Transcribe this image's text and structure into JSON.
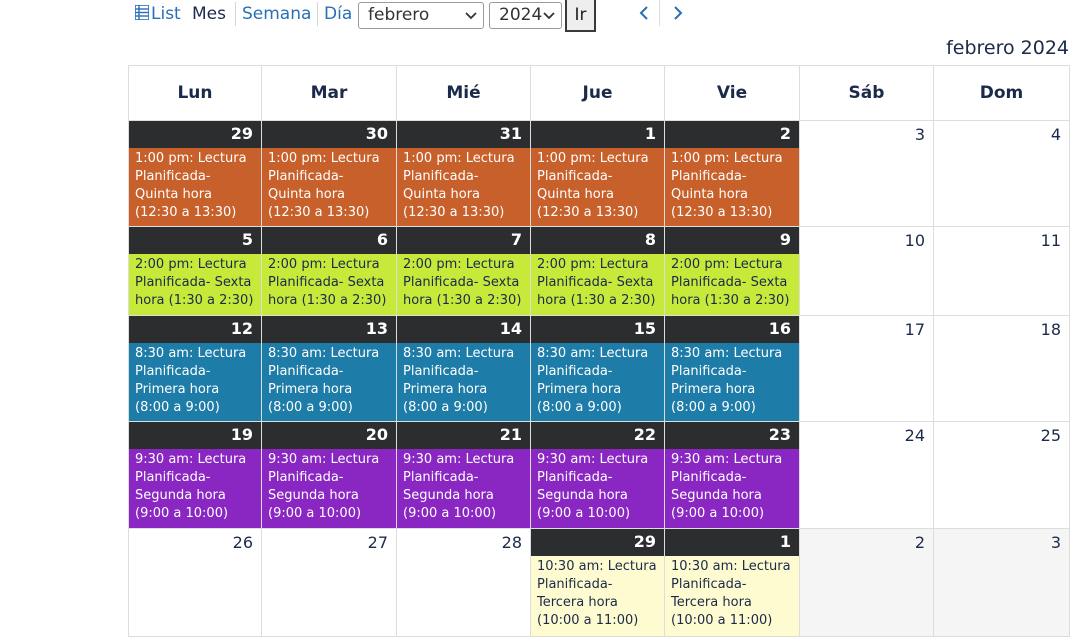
{
  "toolbar": {
    "list_label": "List",
    "month_label": "Mes",
    "week_label": "Semana",
    "day_label": "Día",
    "month_select": "febrero",
    "year_select": "2024",
    "go_label": "Ir"
  },
  "month_title": "febrero 2024",
  "weekdays": [
    "Lun",
    "Mar",
    "Mié",
    "Jue",
    "Vie",
    "Sáb",
    "Dom"
  ],
  "colors": {
    "orange": "#c8602b",
    "lime": "#c7ea3a",
    "blue": "#1e7ca8",
    "purple": "#8a27c2",
    "cream": "#fdfbcf",
    "dark_header": "#2b2d2f"
  },
  "weeks": [
    {
      "days": [
        "29",
        "30",
        "31",
        "1",
        "2",
        "3",
        "4"
      ],
      "event_text": "1:00 pm: Lectura Planificada- Quinta hora (12:30 a 13:30)",
      "event_color": "#c8602b",
      "event_text_color": "#ffffff",
      "event_days": [
        0,
        1,
        2,
        3,
        4
      ],
      "grey_days": []
    },
    {
      "days": [
        "5",
        "6",
        "7",
        "8",
        "9",
        "10",
        "11"
      ],
      "event_text": "2:00 pm: Lectura Planificada- Sexta hora (1:30 a 2:30)",
      "event_color": "#c7ea3a",
      "event_text_color": "#1b2a4a",
      "event_days": [
        0,
        1,
        2,
        3,
        4
      ],
      "grey_days": []
    },
    {
      "days": [
        "12",
        "13",
        "14",
        "15",
        "16",
        "17",
        "18"
      ],
      "event_text": "8:30 am: Lectura Planificada- Primera hora (8:00 a 9:00)",
      "event_color": "#1e7ca8",
      "event_text_color": "#ffffff",
      "event_days": [
        0,
        1,
        2,
        3,
        4
      ],
      "grey_days": []
    },
    {
      "days": [
        "19",
        "20",
        "21",
        "22",
        "23",
        "24",
        "25"
      ],
      "event_text": "9:30 am: Lectura Planificada- Segunda hora (9:00 a 10:00)",
      "event_color": "#8a27c2",
      "event_text_color": "#ffffff",
      "event_days": [
        0,
        1,
        2,
        3,
        4
      ],
      "grey_days": []
    },
    {
      "days": [
        "26",
        "27",
        "28",
        "29",
        "1",
        "2",
        "3"
      ],
      "event_text": "10:30 am: Lectura Planificada- Tercera hora (10:00 a 11:00)",
      "event_color": "#fdfbcf",
      "event_text_color": "#1b2a4a",
      "event_days": [
        3,
        4
      ],
      "grey_days": [
        5,
        6
      ]
    }
  ]
}
